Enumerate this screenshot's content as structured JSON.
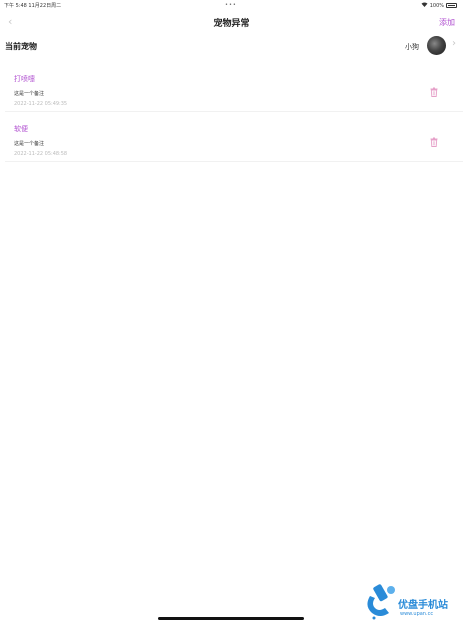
{
  "status_bar": {
    "time": "下午 5:48",
    "date": "11月22日周二",
    "dots": "•••",
    "battery": "100%"
  },
  "nav": {
    "back_icon": "chevron-left-icon",
    "title": "宠物异常",
    "add_label": "添加"
  },
  "current_pet": {
    "label": "当前宠物",
    "name": "小狗",
    "chevron_icon": "chevron-right-icon"
  },
  "records": [
    {
      "type": "打喷嚏",
      "note": "这是一个备注",
      "time": "2022-11-22 05:49:35"
    },
    {
      "type": "软便",
      "note": "这是一个备注",
      "time": "2022-11-22 05:48:58"
    }
  ],
  "watermark": {
    "name": "优盘手机站",
    "url": "www.upan.cc"
  },
  "colors": {
    "accent": "#b04fd0",
    "muted": "#bbbbbb",
    "trash": "#e6a0c8",
    "watermark": "#2a8bd8"
  }
}
